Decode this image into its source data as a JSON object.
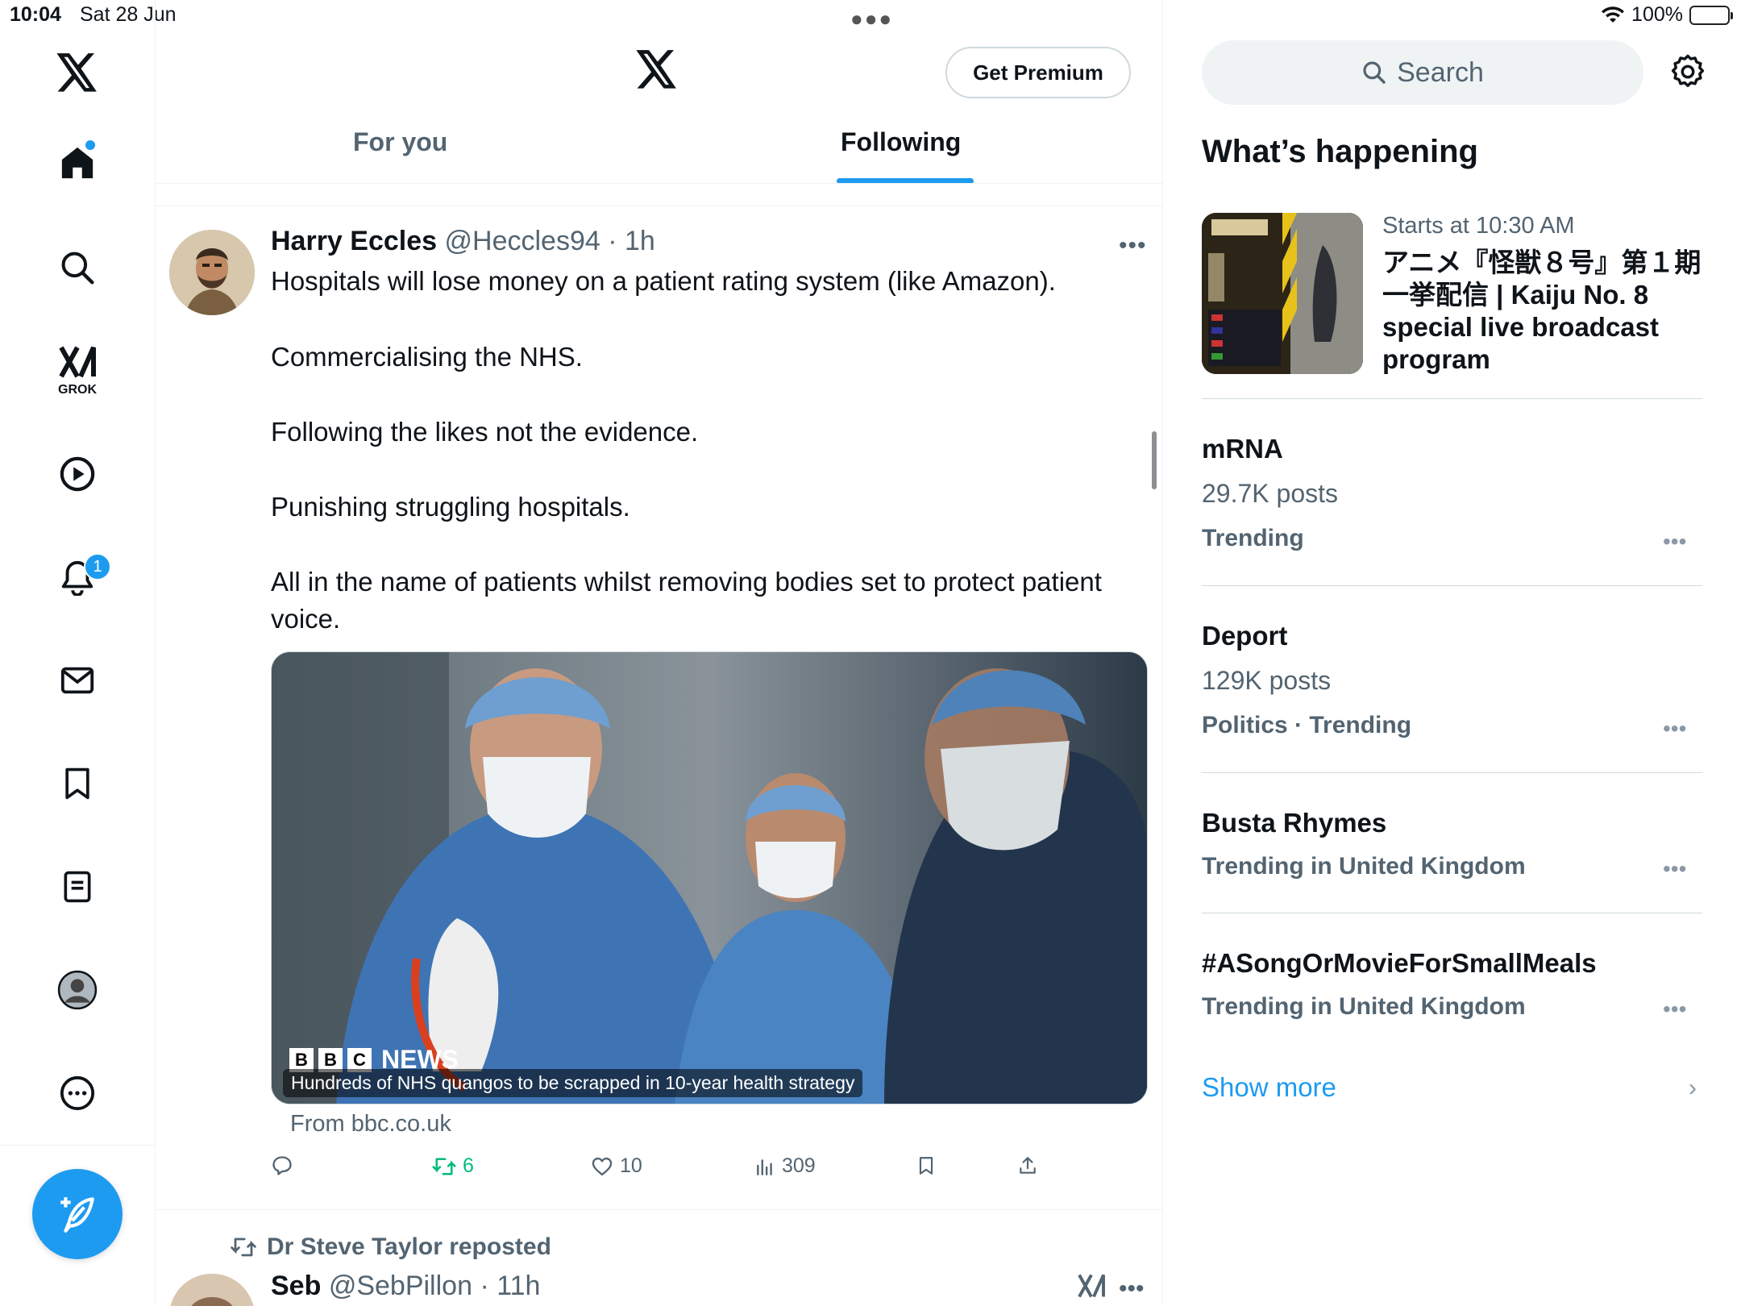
{
  "status": {
    "time": "10:04",
    "date": "Sat 28 Jun",
    "battery": "100%"
  },
  "sidebar": {
    "grok_label": "GROK",
    "notifications_badge": "1"
  },
  "header": {
    "premium_label": "Get Premium",
    "tabs": [
      {
        "label": "For you",
        "active": false
      },
      {
        "label": "Following",
        "active": true
      }
    ]
  },
  "post": {
    "author_name": "Harry Eccles",
    "author_handle": "@Heccles94",
    "time": "· 1h",
    "lines": [
      "Hospitals will lose money on a patient rating system (like Amazon).",
      "Commercialising the NHS.",
      "Following the likes not the evidence.",
      "Punishing struggling hospitals.",
      "All in the name of patients whilst removing bodies set to protect patient",
      "voice."
    ],
    "card_caption": "Hundreds of NHS quangos to be scrapped in 10-year health strategy",
    "card_brand": "NEWS",
    "card_source": "From bbc.co.uk",
    "retweets": "6",
    "likes": "10",
    "views": "309"
  },
  "next_post": {
    "repost_label": "Dr Steve Taylor reposted",
    "author_name": "Seb",
    "author_handle": "@SebPillon",
    "time": "· 11h"
  },
  "right": {
    "search_placeholder": "Search",
    "section_title": "What’s happening",
    "event": {
      "subtitle": "Starts at 10:30 AM",
      "title": "アニメ『怪獣８号』第１期一挙配信 | Kaiju No. 8 special live broadcast program"
    },
    "trends": [
      {
        "name": "mRNA",
        "count": "29.7K posts",
        "category": "Trending"
      },
      {
        "name": "Deport",
        "count": "129K posts",
        "category": "Politics · Trending"
      },
      {
        "name": "Busta Rhymes",
        "count": "",
        "category": "Trending in United Kingdom"
      },
      {
        "name": "#ASongOrMovieForSmallMeals",
        "count": "",
        "category": "Trending in United Kingdom"
      }
    ],
    "show_more": "Show more"
  },
  "colors": {
    "accent": "#1d9bf0",
    "retweet_green": "#00ba7c",
    "secondary_text": "#536471"
  }
}
